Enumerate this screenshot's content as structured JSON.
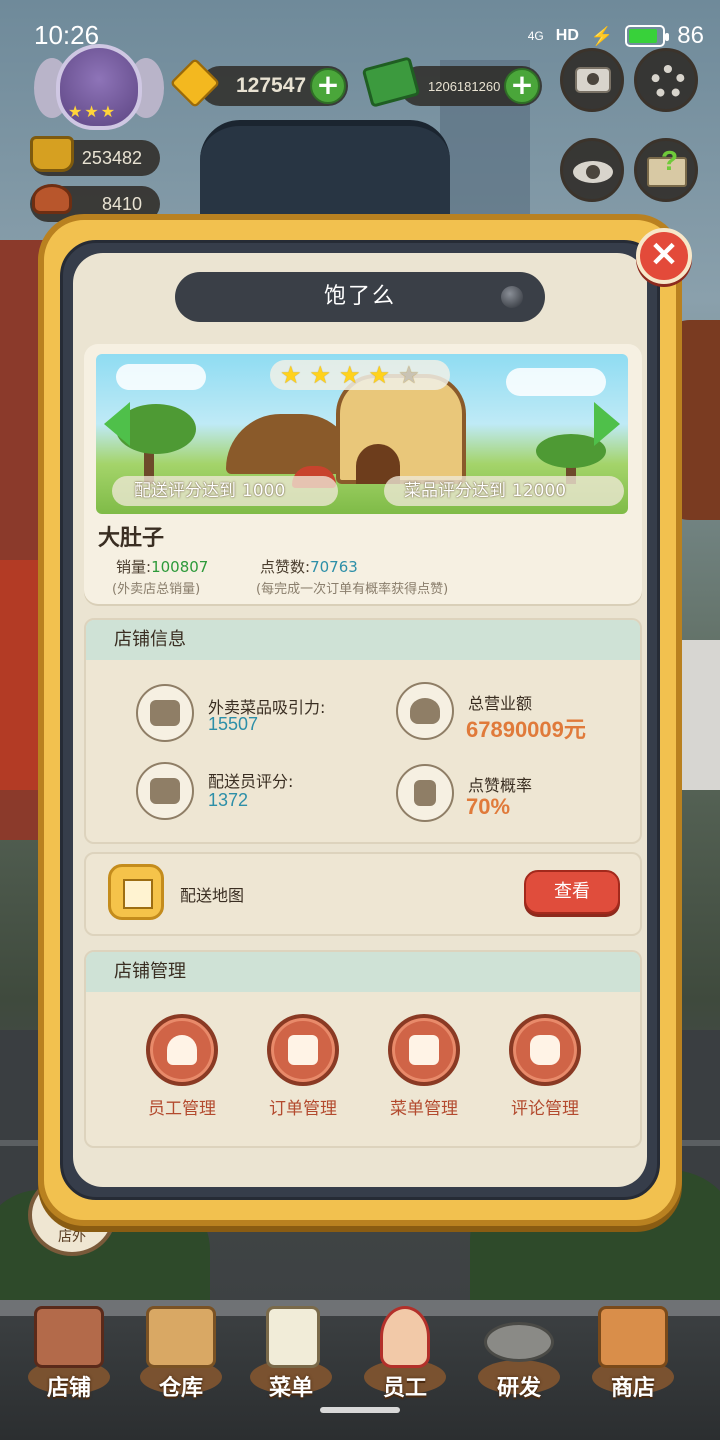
{
  "status_bar": {
    "time": "10:26",
    "network": "4G",
    "hd": "HD",
    "battery": "86",
    "battery_level": 0.86
  },
  "hud": {
    "gems": "127547",
    "cash": "1206181260",
    "gold_count": "253482",
    "dish_count": "8410",
    "icons": [
      "rank-badge-icon",
      "gem-icon",
      "cash-icon",
      "camera-icon",
      "settings-gear-icon",
      "eye-icon",
      "help-book-icon"
    ]
  },
  "modal": {
    "title": "饱了么",
    "close_glyph": "✕",
    "shop": {
      "rating_stars": 4,
      "rating_max": 5,
      "delivery_req_label": "配送评分达到",
      "delivery_req_value": "1000",
      "dish_req_label": "菜品评分达到",
      "dish_req_value": "12000",
      "name": "大肚子",
      "sales_label": "销量:",
      "sales_value": "100807",
      "sales_note": "(外卖店总销量)",
      "likes_label": "点赞数:",
      "likes_value": "70763",
      "likes_note": "(每完成一次订单有概率获得点赞)"
    },
    "store_info": {
      "header": "店铺信息",
      "items": [
        {
          "label": "外卖菜品吸引力:",
          "value": "15507",
          "icon": "dish-plate-icon"
        },
        {
          "label": "总营业额",
          "value": "67890009元",
          "icon": "money-bag-icon"
        },
        {
          "label": "配送员评分:",
          "value": "1372",
          "icon": "delivery-scooter-icon"
        },
        {
          "label": "点赞概率",
          "value": "70%",
          "icon": "thumbs-up-icon"
        }
      ]
    },
    "map": {
      "label": "配送地图",
      "button": "查看"
    },
    "management": {
      "header": "店铺管理",
      "items": [
        {
          "label": "员工管理",
          "icon": "staff-icon"
        },
        {
          "label": "订单管理",
          "icon": "orders-icon"
        },
        {
          "label": "菜单管理",
          "icon": "menu-clipboard-icon"
        },
        {
          "label": "评论管理",
          "icon": "chat-bubble-icon"
        }
      ]
    }
  },
  "outside_button": "店外",
  "bottom_nav": [
    {
      "label": "店铺",
      "icon": "shop-icon"
    },
    {
      "label": "仓库",
      "icon": "warehouse-icon"
    },
    {
      "label": "菜单",
      "icon": "menu-icon"
    },
    {
      "label": "员工",
      "icon": "staff-chef-icon"
    },
    {
      "label": "研发",
      "icon": "research-pot-icon"
    },
    {
      "label": "商店",
      "icon": "store-icon"
    }
  ]
}
